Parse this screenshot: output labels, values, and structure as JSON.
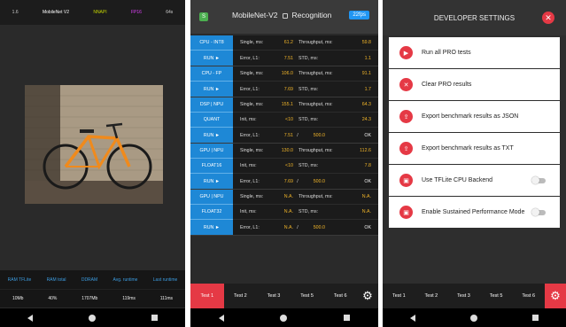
{
  "screen1": {
    "status": [
      "1.6",
      "MobileNet V2",
      "NNAPI",
      "FP16",
      "64s"
    ],
    "status_colors": [
      "#cccccc",
      "#ffffff",
      "#c3d400",
      "#e040fb",
      "#cccccc"
    ],
    "stat_labels": [
      "RAM TFLite",
      "RAM total",
      "DDRAM",
      "Avg. runtime",
      "Last runtime"
    ],
    "stat_values": [
      "10Mb",
      "40%",
      "1707Mb",
      "119ms",
      "111ms"
    ]
  },
  "screen2": {
    "header": {
      "badge": "S",
      "title": "MobileNet-V2",
      "mode": "Recognition",
      "fps": "22fps"
    },
    "blocks": [
      {
        "side": [
          "CPU - INT8",
          "RUN ►"
        ],
        "rows": [
          {
            "l1": "Single, ms:",
            "v1": "61.2",
            "l2": "Throughput, ms:",
            "v3": "59.8"
          },
          {
            "l1": "Error, L1:",
            "v1": "7.51",
            "l2": "STD, ms:",
            "v3": "1.1"
          }
        ]
      },
      {
        "side": [
          "CPU - FP",
          "RUN ►"
        ],
        "rows": [
          {
            "l1": "Single, ms:",
            "v1": "106.0",
            "l2": "Throughput, ms:",
            "v3": "91.1"
          },
          {
            "l1": "Error, L1:",
            "v1": "7.69",
            "l2": "STD, ms:",
            "v3": "1.7"
          }
        ]
      },
      {
        "side": [
          "DSP | NPU",
          "QUANT",
          "RUN ►"
        ],
        "rows": [
          {
            "l1": "Single, ms:",
            "v1": "155.1",
            "l2": "Throughput, ms:",
            "v3": "64.3"
          },
          {
            "l1": "Init, ms:",
            "v1": "<10",
            "l2": "STD, ms:",
            "v3": "24.3"
          },
          {
            "l1": "Error, L1:",
            "v1": "7.51",
            "sl": "/",
            "v2": "500.0",
            "v3": "OK"
          }
        ]
      },
      {
        "side": [
          "GPU | NPU",
          "FLOAT16",
          "RUN ►"
        ],
        "rows": [
          {
            "l1": "Single, ms:",
            "v1": "130.0",
            "l2": "Throughput, ms:",
            "v3": "112.6"
          },
          {
            "l1": "Init, ms:",
            "v1": "<10",
            "l2": "STD, ms:",
            "v3": "7.8"
          },
          {
            "l1": "Error, L1:",
            "v1": "7.69",
            "sl": "/",
            "v2": "500.0",
            "v3": "OK"
          }
        ]
      },
      {
        "side": [
          "GPU | NPU",
          "FLOAT32",
          "RUN ►"
        ],
        "rows": [
          {
            "l1": "Single, ms:",
            "v1": "N.A.",
            "l2": "Throughput, ms:",
            "v3": "N.A."
          },
          {
            "l1": "Init, ms:",
            "v1": "N.A.",
            "l2": "STD, ms:",
            "v3": "N.A."
          },
          {
            "l1": "Error, L1:",
            "v1": "N.A.",
            "sl": "/",
            "v2": "500.0",
            "v3": "OK"
          }
        ]
      }
    ],
    "tabs": [
      "Test 1",
      "Test 2",
      "Test 3",
      "Test 5",
      "Test 6"
    ],
    "active_tab": 0
  },
  "screen3": {
    "title": "DEVELOPER  SETTINGS",
    "options": [
      {
        "label": "Run all PRO tests",
        "icon": "play-icon",
        "glyph": "▶",
        "toggle": false
      },
      {
        "label": "Clear PRO results",
        "icon": "close-icon",
        "glyph": "✕",
        "toggle": false
      },
      {
        "label": "Export benchmark results as JSON",
        "icon": "export-icon",
        "glyph": "⇪",
        "toggle": false
      },
      {
        "label": "Export benchmark results as TXT",
        "icon": "export-icon",
        "glyph": "⇪",
        "toggle": false
      },
      {
        "label": "Use TFLite CPU Backend",
        "icon": "chip-icon",
        "glyph": "▣",
        "toggle": true
      },
      {
        "label": "Enable Sustained Performance Mode",
        "icon": "chip-icon",
        "glyph": "▣",
        "toggle": true
      }
    ],
    "tabs": [
      "Test 1",
      "Test 2",
      "Test 3",
      "Test 5",
      "Test 6"
    ]
  },
  "colors": {
    "accent_red": "#e53945",
    "accent_blue": "#1e88d6",
    "value_yellow": "#f0b429"
  }
}
